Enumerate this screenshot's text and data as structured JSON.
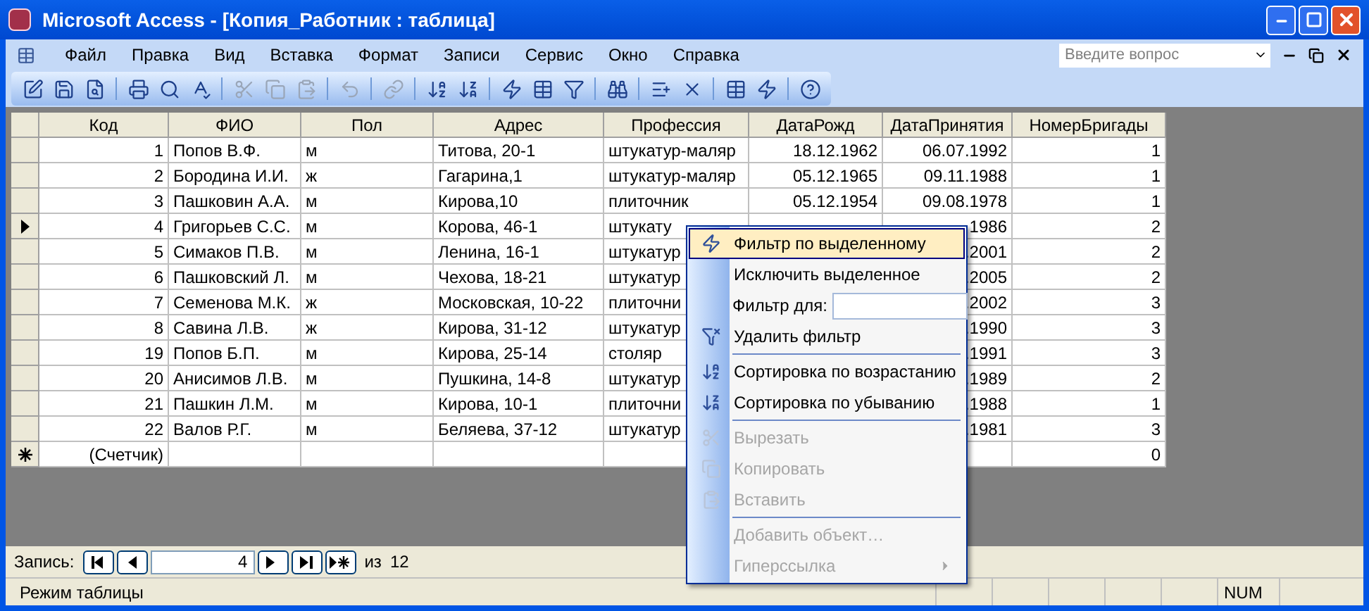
{
  "window": {
    "title": "Microsoft Access - [Копия_Работник : таблица]"
  },
  "menu_bar": [
    "Файл",
    "Правка",
    "Вид",
    "Вставка",
    "Формат",
    "Записи",
    "Сервис",
    "Окно",
    "Справка"
  ],
  "help_search": {
    "placeholder": "Введите вопрос"
  },
  "toolbar": [
    {
      "disabled": false
    },
    {
      "disabled": false
    },
    {
      "disabled": false
    },
    {
      "disabled": false
    },
    {
      "disabled": false
    },
    {
      "disabled": false
    },
    {
      "disabled": true
    },
    {
      "disabled": true
    },
    {
      "disabled": true
    },
    {
      "disabled": true
    },
    {
      "disabled": true
    },
    {
      "disabled": false
    },
    {
      "disabled": false
    },
    {
      "disabled": false
    },
    {
      "disabled": false
    },
    {
      "disabled": false
    },
    {
      "disabled": false
    },
    {
      "disabled": false
    },
    {
      "disabled": false
    },
    {
      "disabled": false
    },
    {
      "disabled": false
    },
    {
      "disabled": false
    }
  ],
  "table": {
    "columns": [
      "Код",
      "ФИО",
      "Пол",
      "Адрес",
      "Профессия",
      "ДатаРожд",
      "ДатаПринятия",
      "НомерБригады"
    ],
    "rows": [
      {
        "kind": "record",
        "current": false,
        "code": "1",
        "name": "Попов В.Ф.",
        "sex": "м",
        "address": "Титова, 20-1",
        "profession": "штукатур-маляр",
        "birth_date": "18.12.1962",
        "hire_date": "06.07.1992",
        "team": "1"
      },
      {
        "kind": "record",
        "current": false,
        "code": "2",
        "name": "Бородина И.И.",
        "sex": "ж",
        "address": "Гагарина,1",
        "profession": "штукатур-маляр",
        "birth_date": "05.12.1965",
        "hire_date": "09.11.1988",
        "team": "1"
      },
      {
        "kind": "record",
        "current": false,
        "code": "3",
        "name": "Пашковин А.А.",
        "sex": "м",
        "address": "Кирова,10",
        "profession": "плиточник",
        "birth_date": "05.12.1954",
        "hire_date": "09.08.1978",
        "team": "1"
      },
      {
        "kind": "record",
        "current": true,
        "code": "4",
        "name": "Григорьев С.С.",
        "sex": "м",
        "address": "Корова, 46-1",
        "profession": "штукату",
        "hire_date": "1986",
        "team": "2"
      },
      {
        "kind": "record",
        "current": false,
        "code": "5",
        "name": "Симаков П.В.",
        "sex": "м",
        "address": "Ленина, 16-1",
        "profession": "штукатур",
        "hire_date": ".2001",
        "team": "2"
      },
      {
        "kind": "record",
        "current": false,
        "code": "6",
        "name": "Пашковский Л.",
        "sex": "м",
        "address": "Чехова, 18-21",
        "profession": "штукатур",
        "hire_date": ".2005",
        "team": "2"
      },
      {
        "kind": "record",
        "current": false,
        "code": "7",
        "name": "Семенова М.К.",
        "sex": "ж",
        "address": "Московская, 10-22",
        "profession": "плиточни",
        "hire_date": ".2002",
        "team": "3"
      },
      {
        "kind": "record",
        "current": false,
        "code": "8",
        "name": "Савина Л.В.",
        "sex": "ж",
        "address": "Кирова, 31-12",
        "profession": "штукатур",
        "hire_date": ".1990",
        "team": "3"
      },
      {
        "kind": "record",
        "current": false,
        "code": "19",
        "name": "Попов Б.П.",
        "sex": "м",
        "address": "Кирова, 25-14",
        "profession": "столяр",
        "hire_date": ".1991",
        "team": "3"
      },
      {
        "kind": "record",
        "current": false,
        "code": "20",
        "name": "Анисимов Л.В.",
        "sex": "м",
        "address": "Пушкина, 14-8",
        "profession": "штукатур",
        "hire_date": ".1989",
        "team": "2"
      },
      {
        "kind": "record",
        "current": false,
        "code": "21",
        "name": "Пашкин Л.М.",
        "sex": "м",
        "address": "Кирова, 10-1",
        "profession": "плиточни",
        "hire_date": ".1988",
        "team": "1"
      },
      {
        "kind": "record",
        "current": false,
        "code": "22",
        "name": "Валов Р.Г.",
        "sex": "м",
        "address": "Беляева, 37-12",
        "profession": "штукатур",
        "hire_date": ".1981",
        "team": "3"
      },
      {
        "kind": "new",
        "current": false,
        "code": "(Счетчик)",
        "team": "0"
      }
    ]
  },
  "record_nav": {
    "label": "Запись:",
    "current": "4",
    "of": "из",
    "total": "12"
  },
  "status_bar": {
    "mode": "Режим таблицы",
    "num": "NUM"
  },
  "context_menu": [
    {
      "kind": "item",
      "label": "Фильтр по выделенному",
      "selected": true,
      "disabled": false
    },
    {
      "kind": "item",
      "label": "Исключить выделенное",
      "selected": false,
      "disabled": false
    },
    {
      "kind": "field",
      "label": "Фильтр для:"
    },
    {
      "kind": "item",
      "label": "Удалить фильтр",
      "selected": false,
      "disabled": false
    },
    {
      "kind": "separator"
    },
    {
      "kind": "item",
      "label": "Сортировка по возрастанию",
      "selected": false,
      "disabled": false
    },
    {
      "kind": "item",
      "label": "Сортировка по убыванию",
      "selected": false,
      "disabled": false
    },
    {
      "kind": "separator"
    },
    {
      "kind": "item",
      "label": "Вырезать",
      "selected": false,
      "disabled": true
    },
    {
      "kind": "item",
      "label": "Копировать",
      "selected": false,
      "disabled": true
    },
    {
      "kind": "item",
      "label": "Вставить",
      "selected": false,
      "disabled": true
    },
    {
      "kind": "separator"
    },
    {
      "kind": "item",
      "label": "Добавить объект…",
      "selected": false,
      "disabled": true
    },
    {
      "kind": "submenu",
      "label": "Гиперссылка",
      "selected": false,
      "disabled": true
    }
  ]
}
